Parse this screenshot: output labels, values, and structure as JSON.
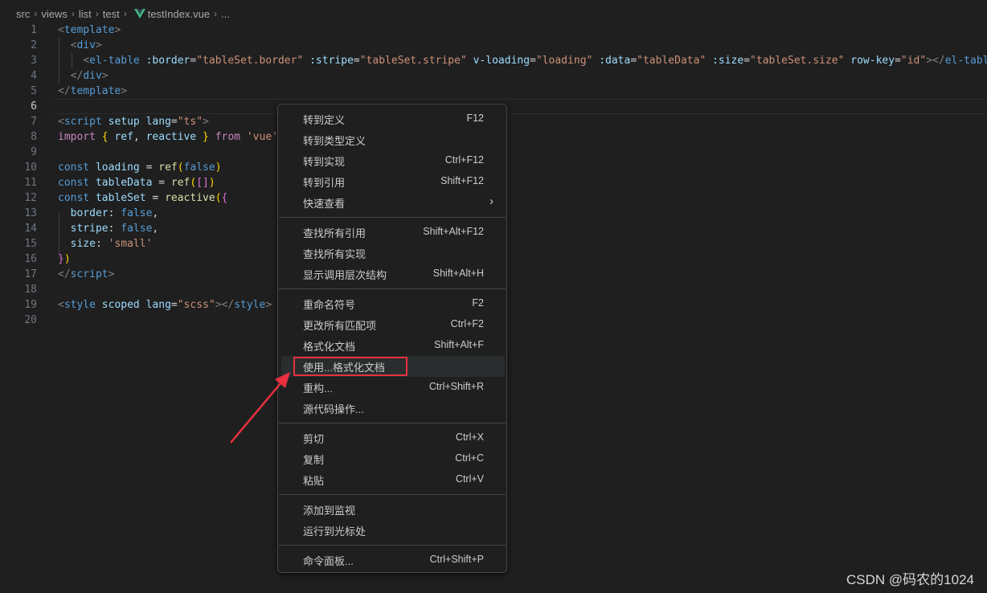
{
  "breadcrumb": {
    "segments": [
      "src",
      "views",
      "list",
      "test"
    ],
    "file": "testIndex.vue",
    "trailing": "..."
  },
  "editor": {
    "active_line": 6,
    "lines": [
      {
        "n": "1",
        "tokens": [
          [
            "t-punc",
            "<"
          ],
          [
            "t-tag",
            "template"
          ],
          [
            "t-punc",
            ">"
          ]
        ]
      },
      {
        "n": "2",
        "tokens": [
          [
            "t-txt",
            "  "
          ],
          [
            "t-punc",
            "<"
          ],
          [
            "t-tag",
            "div"
          ],
          [
            "t-punc",
            ">"
          ]
        ]
      },
      {
        "n": "3",
        "tokens": [
          [
            "t-txt",
            "    "
          ],
          [
            "t-punc",
            "<"
          ],
          [
            "t-tag",
            "el-table"
          ],
          [
            "t-txt",
            " "
          ],
          [
            "t-attr",
            ":border"
          ],
          [
            "t-txt",
            "="
          ],
          [
            "t-str",
            "\"tableSet.border\""
          ],
          [
            "t-txt",
            " "
          ],
          [
            "t-attr",
            ":stripe"
          ],
          [
            "t-txt",
            "="
          ],
          [
            "t-str",
            "\"tableSet.stripe\""
          ],
          [
            "t-txt",
            " "
          ],
          [
            "t-attr",
            "v-loading"
          ],
          [
            "t-txt",
            "="
          ],
          [
            "t-str",
            "\"loading\""
          ],
          [
            "t-txt",
            " "
          ],
          [
            "t-attr",
            ":data"
          ],
          [
            "t-txt",
            "="
          ],
          [
            "t-str",
            "\"tableData\""
          ],
          [
            "t-txt",
            " "
          ],
          [
            "t-attr",
            ":size"
          ],
          [
            "t-txt",
            "="
          ],
          [
            "t-str",
            "\"tableSet.size\""
          ],
          [
            "t-txt",
            " "
          ],
          [
            "t-attr",
            "row-key"
          ],
          [
            "t-txt",
            "="
          ],
          [
            "t-str",
            "\"id\""
          ],
          [
            "t-punc",
            "></"
          ],
          [
            "t-tag",
            "el-table"
          ],
          [
            "t-punc",
            ">"
          ]
        ]
      },
      {
        "n": "4",
        "tokens": [
          [
            "t-txt",
            "  "
          ],
          [
            "t-punc",
            "</"
          ],
          [
            "t-tag",
            "div"
          ],
          [
            "t-punc",
            ">"
          ]
        ]
      },
      {
        "n": "5",
        "tokens": [
          [
            "t-punc",
            "</"
          ],
          [
            "t-tag",
            "template"
          ],
          [
            "t-punc",
            ">"
          ]
        ]
      },
      {
        "n": "6",
        "tokens": []
      },
      {
        "n": "7",
        "tokens": [
          [
            "t-punc",
            "<"
          ],
          [
            "t-tag",
            "script"
          ],
          [
            "t-txt",
            " "
          ],
          [
            "t-attr",
            "setup"
          ],
          [
            "t-txt",
            " "
          ],
          [
            "t-attr",
            "lang"
          ],
          [
            "t-txt",
            "="
          ],
          [
            "t-str",
            "\"ts\""
          ],
          [
            "t-punc",
            ">"
          ]
        ]
      },
      {
        "n": "8",
        "tokens": [
          [
            "t-imp",
            "import"
          ],
          [
            "t-txt",
            " "
          ],
          [
            "t-b1",
            "{"
          ],
          [
            "t-txt",
            " "
          ],
          [
            "t-var",
            "ref"
          ],
          [
            "t-txt",
            ", "
          ],
          [
            "t-var",
            "reactive"
          ],
          [
            "t-txt",
            " "
          ],
          [
            "t-b1",
            "}"
          ],
          [
            "t-txt",
            " "
          ],
          [
            "t-imp",
            "from"
          ],
          [
            "t-txt",
            " "
          ],
          [
            "t-str",
            "'vue'"
          ]
        ]
      },
      {
        "n": "9",
        "tokens": []
      },
      {
        "n": "10",
        "tokens": [
          [
            "t-kw",
            "const"
          ],
          [
            "t-txt",
            " "
          ],
          [
            "t-var",
            "loading"
          ],
          [
            "t-txt",
            " = "
          ],
          [
            "t-fn",
            "ref"
          ],
          [
            "t-b1",
            "("
          ],
          [
            "t-kw",
            "false"
          ],
          [
            "t-b1",
            ")"
          ]
        ]
      },
      {
        "n": "11",
        "tokens": [
          [
            "t-kw",
            "const"
          ],
          [
            "t-txt",
            " "
          ],
          [
            "t-var",
            "tableData"
          ],
          [
            "t-txt",
            " = "
          ],
          [
            "t-fn",
            "ref"
          ],
          [
            "t-b1",
            "("
          ],
          [
            "t-b2",
            "[]"
          ],
          [
            "t-b1",
            ")"
          ]
        ]
      },
      {
        "n": "12",
        "tokens": [
          [
            "t-kw",
            "const"
          ],
          [
            "t-txt",
            " "
          ],
          [
            "t-var",
            "tableSet"
          ],
          [
            "t-txt",
            " = "
          ],
          [
            "t-fn",
            "reactive"
          ],
          [
            "t-b1",
            "("
          ],
          [
            "t-b2",
            "{"
          ]
        ]
      },
      {
        "n": "13",
        "tokens": [
          [
            "t-txt",
            "  "
          ],
          [
            "t-var",
            "border"
          ],
          [
            "t-txt",
            ": "
          ],
          [
            "t-kw",
            "false"
          ],
          [
            "t-txt",
            ","
          ]
        ]
      },
      {
        "n": "14",
        "tokens": [
          [
            "t-txt",
            "  "
          ],
          [
            "t-var",
            "stripe"
          ],
          [
            "t-txt",
            ": "
          ],
          [
            "t-kw",
            "false"
          ],
          [
            "t-txt",
            ","
          ]
        ]
      },
      {
        "n": "15",
        "tokens": [
          [
            "t-txt",
            "  "
          ],
          [
            "t-var",
            "size"
          ],
          [
            "t-txt",
            ": "
          ],
          [
            "t-str",
            "'small'"
          ]
        ]
      },
      {
        "n": "16",
        "tokens": [
          [
            "t-b2",
            "}"
          ],
          [
            "t-b1",
            ")"
          ]
        ]
      },
      {
        "n": "17",
        "tokens": [
          [
            "t-punc",
            "</"
          ],
          [
            "t-tag",
            "script"
          ],
          [
            "t-punc",
            ">"
          ]
        ]
      },
      {
        "n": "18",
        "tokens": []
      },
      {
        "n": "19",
        "tokens": [
          [
            "t-punc",
            "<"
          ],
          [
            "t-tag",
            "style"
          ],
          [
            "t-txt",
            " "
          ],
          [
            "t-attr",
            "scoped"
          ],
          [
            "t-txt",
            " "
          ],
          [
            "t-attr",
            "lang"
          ],
          [
            "t-txt",
            "="
          ],
          [
            "t-str",
            "\"scss\""
          ],
          [
            "t-punc",
            "></"
          ],
          [
            "t-tag",
            "style"
          ],
          [
            "t-punc",
            ">"
          ]
        ]
      },
      {
        "n": "20",
        "tokens": []
      }
    ]
  },
  "context_menu": {
    "groups": [
      [
        {
          "id": "go-to-definition",
          "label": "转到定义",
          "key": "F12"
        },
        {
          "id": "go-to-type-definition",
          "label": "转到类型定义",
          "key": ""
        },
        {
          "id": "go-to-implementations",
          "label": "转到实现",
          "key": "Ctrl+F12"
        },
        {
          "id": "go-to-references",
          "label": "转到引用",
          "key": "Shift+F12"
        },
        {
          "id": "peek",
          "label": "快速查看",
          "key": "",
          "submenu": true
        }
      ],
      [
        {
          "id": "find-all-references",
          "label": "查找所有引用",
          "key": "Shift+Alt+F12"
        },
        {
          "id": "find-all-implementations",
          "label": "查找所有实现",
          "key": ""
        },
        {
          "id": "show-call-hierarchy",
          "label": "显示调用层次结构",
          "key": "Shift+Alt+H"
        }
      ],
      [
        {
          "id": "rename-symbol",
          "label": "重命名符号",
          "key": "F2"
        },
        {
          "id": "change-all-occurrences",
          "label": "更改所有匹配项",
          "key": "Ctrl+F2"
        },
        {
          "id": "format-document",
          "label": "格式化文档",
          "key": "Shift+Alt+F"
        },
        {
          "id": "format-document-with",
          "label": "使用...格式化文档",
          "key": "",
          "highlighted": true
        },
        {
          "id": "refactor",
          "label": "重构...",
          "key": "Ctrl+Shift+R"
        },
        {
          "id": "source-action",
          "label": "源代码操作...",
          "key": ""
        }
      ],
      [
        {
          "id": "cut",
          "label": "剪切",
          "key": "Ctrl+X"
        },
        {
          "id": "copy",
          "label": "复制",
          "key": "Ctrl+C"
        },
        {
          "id": "paste",
          "label": "粘贴",
          "key": "Ctrl+V"
        }
      ],
      [
        {
          "id": "add-to-watch",
          "label": "添加到监视",
          "key": ""
        },
        {
          "id": "run-to-cursor",
          "label": "运行到光标处",
          "key": ""
        }
      ],
      [
        {
          "id": "command-palette",
          "label": "命令面板...",
          "key": "Ctrl+Shift+P"
        }
      ]
    ]
  },
  "watermark": "CSDN @码农的1024",
  "colors": {
    "background": "#1f1f1f",
    "annotation_red": "#e8303f",
    "vue_green": "#41b883"
  }
}
